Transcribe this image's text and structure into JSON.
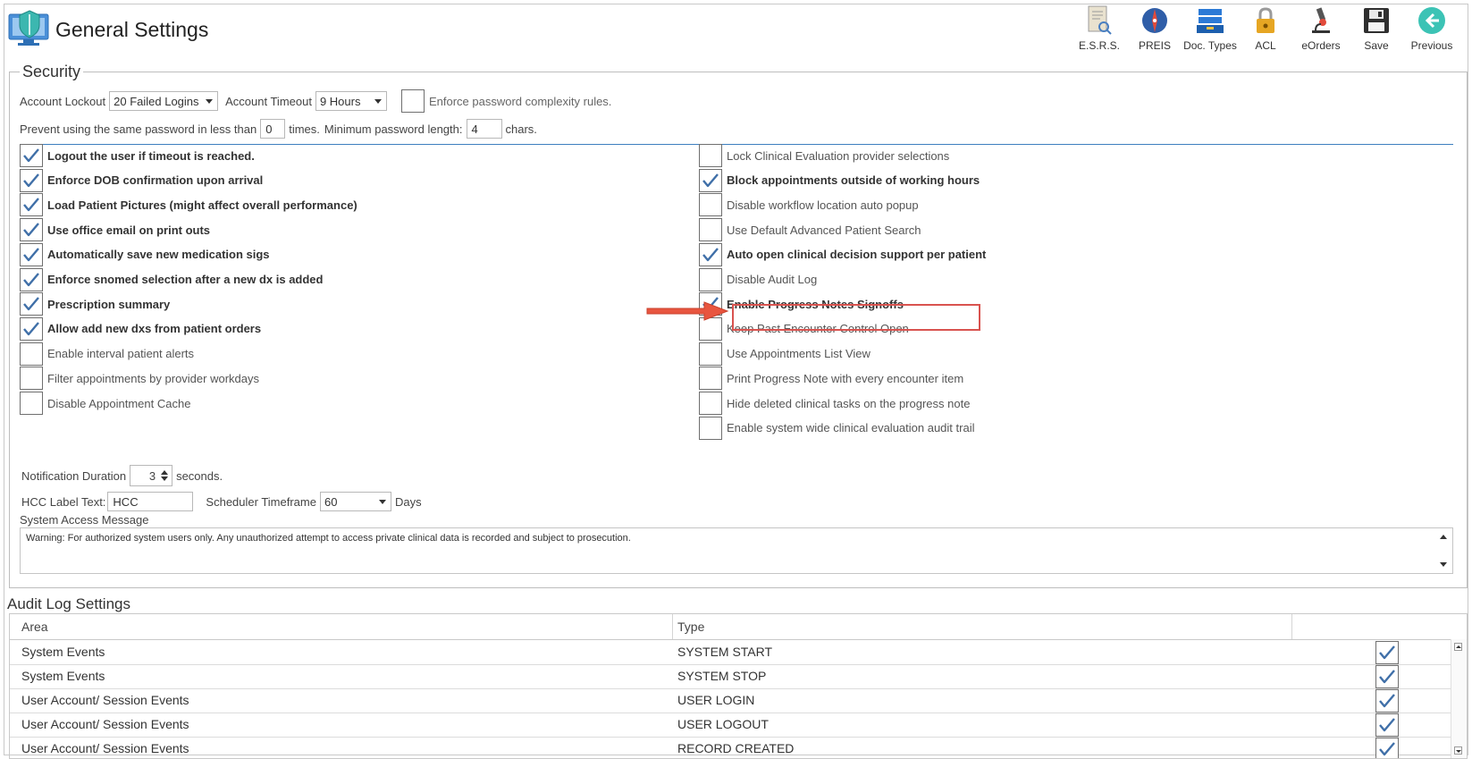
{
  "header": {
    "title": "General Settings",
    "toolbar": [
      {
        "label": "E.S.R.S.",
        "icon": "document-search-icon"
      },
      {
        "label": "PREIS",
        "icon": "preis-globe-icon"
      },
      {
        "label": "Doc. Types",
        "icon": "document-stack-icon"
      },
      {
        "label": "ACL",
        "icon": "padlock-icon"
      },
      {
        "label": "eOrders",
        "icon": "microscope-icon"
      },
      {
        "label": "Save",
        "icon": "floppy-disk-icon"
      },
      {
        "label": "Previous",
        "icon": "back-arrow-icon"
      }
    ]
  },
  "security": {
    "legend": "Security",
    "account_lockout_label": "Account Lockout",
    "account_lockout_value": "20 Failed Logins",
    "account_timeout_label": "Account Timeout",
    "account_timeout_value": "9 Hours",
    "enforce_complexity_label": "Enforce password complexity rules.",
    "prevent_reuse_label": "Prevent using the same password in less than",
    "prevent_reuse_value": "0",
    "times_label": "times.",
    "min_length_label": "Minimum password length:",
    "min_length_value": "4",
    "chars_label": "chars.",
    "left_checks": [
      {
        "label": "Logout the user if timeout is reached.",
        "checked": true
      },
      {
        "label": "Enforce DOB confirmation upon arrival",
        "checked": true
      },
      {
        "label": "Load Patient Pictures (might affect overall performance)",
        "checked": true
      },
      {
        "label": "Use office email on print outs",
        "checked": true
      },
      {
        "label": "Automatically save new medication sigs",
        "checked": true
      },
      {
        "label": "Enforce snomed selection after a new dx is added",
        "checked": true
      },
      {
        "label": "Prescription summary",
        "checked": true
      },
      {
        "label": "Allow add new dxs from patient orders",
        "checked": true
      },
      {
        "label": "Enable interval patient alerts",
        "checked": false
      },
      {
        "label": "Filter appointments by provider workdays",
        "checked": false
      },
      {
        "label": "Disable Appointment Cache",
        "checked": false
      }
    ],
    "right_checks": [
      {
        "label": "Lock Clinical Evaluation provider selections",
        "checked": false
      },
      {
        "label": "Block appointments outside of working hours",
        "checked": true
      },
      {
        "label": "Disable workflow location auto popup",
        "checked": false
      },
      {
        "label": "Use Default Advanced Patient Search",
        "checked": false
      },
      {
        "label": "Auto open clinical decision support per patient",
        "checked": true
      },
      {
        "label": "Disable Audit Log",
        "checked": false
      },
      {
        "label": "Enable Progress Notes Signoffs",
        "checked": true
      },
      {
        "label": "Keep Past Encounter Control Open",
        "checked": false
      },
      {
        "label": "Use Appointments List View",
        "checked": false
      },
      {
        "label": "Print Progress Note with every encounter item",
        "checked": false
      },
      {
        "label": "Hide deleted clinical tasks on the progress note",
        "checked": false
      },
      {
        "label": "Enable system wide clinical evaluation audit trail",
        "checked": false
      }
    ],
    "notification_label": "Notification Duration",
    "notification_value": "3",
    "seconds_label": "seconds.",
    "hcc_label": "HCC Label Text:",
    "hcc_value": "HCC",
    "scheduler_label": "Scheduler Timeframe",
    "scheduler_value": "60",
    "days_label": "Days",
    "access_message_label": "System Access Message",
    "access_message": "Warning: For authorized system users only. Any unauthorized attempt to access private clinical data is recorded and subject to prosecution."
  },
  "audit": {
    "title": "Audit Log Settings",
    "columns": [
      "Area",
      "Type"
    ],
    "rows": [
      {
        "area": "System Events",
        "type": "SYSTEM START",
        "checked": true
      },
      {
        "area": "System Events",
        "type": "SYSTEM STOP",
        "checked": true
      },
      {
        "area": "User Account/ Session Events",
        "type": "USER LOGIN",
        "checked": true
      },
      {
        "area": "User Account/ Session Events",
        "type": "USER LOGOUT",
        "checked": true
      },
      {
        "area": "User Account/ Session Events",
        "type": "RECORD CREATED",
        "checked": true
      }
    ]
  },
  "colors": {
    "check": "#3f6fa8",
    "highlight": "#d9534f",
    "arrow": "#e8553f",
    "separator": "#3e7fbf"
  }
}
